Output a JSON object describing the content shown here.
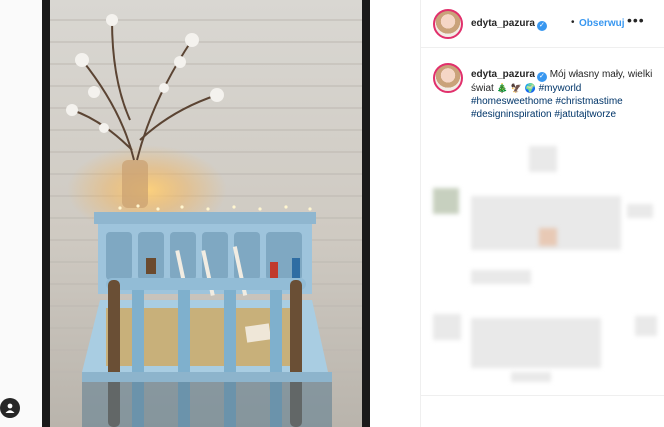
{
  "post": {
    "author": "edyta_pazura",
    "follow_label": "Obserwuj",
    "dot": "•",
    "caption_text": "Mój własny mały, wielki świat",
    "caption_emojis": [
      "🎄",
      "🦅",
      "🌍"
    ],
    "hashtags": [
      "#myworld",
      "#homesweethome",
      "#christmastime",
      "#designinspiration",
      "#jatutajtworze"
    ]
  },
  "colors": {
    "link": "#3897f0",
    "hashtag": "#003569",
    "avatar_ring": "#e1306c"
  },
  "icons": {
    "verified": "verified-badge-icon",
    "more": "more-options-icon",
    "user": "user-icon"
  }
}
